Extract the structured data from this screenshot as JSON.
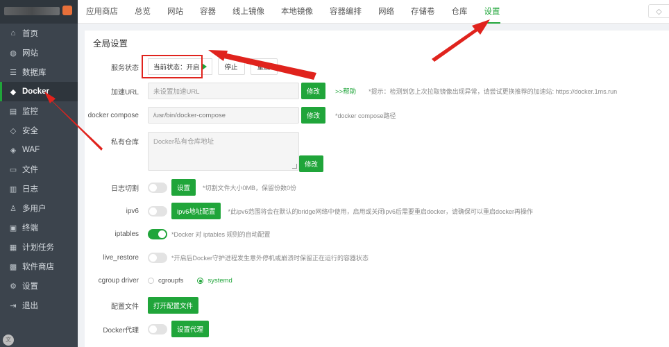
{
  "sidebar": {
    "items": [
      {
        "icon": "home-icon",
        "glyph": "⌂",
        "label": "首页"
      },
      {
        "icon": "globe-icon",
        "glyph": "◍",
        "label": "网站"
      },
      {
        "icon": "database-icon",
        "glyph": "☰",
        "label": "数据库"
      },
      {
        "icon": "docker-icon",
        "glyph": "◆",
        "label": "Docker"
      },
      {
        "icon": "monitor-icon",
        "glyph": "▤",
        "label": "监控"
      },
      {
        "icon": "shield-icon",
        "glyph": "◇",
        "label": "安全"
      },
      {
        "icon": "waf-shield-icon",
        "glyph": "◈",
        "label": "WAF"
      },
      {
        "icon": "folder-icon",
        "glyph": "▭",
        "label": "文件"
      },
      {
        "icon": "log-icon",
        "glyph": "▥",
        "label": "日志"
      },
      {
        "icon": "users-icon",
        "glyph": "♙",
        "label": "多用户"
      },
      {
        "icon": "terminal-icon",
        "glyph": "▣",
        "label": "终端"
      },
      {
        "icon": "schedule-icon",
        "glyph": "▦",
        "label": "计划任务"
      },
      {
        "icon": "store-icon",
        "glyph": "▩",
        "label": "软件商店"
      },
      {
        "icon": "gear-icon",
        "glyph": "⚙",
        "label": "设置"
      },
      {
        "icon": "logout-icon",
        "glyph": "⇥",
        "label": "退出"
      }
    ],
    "active_index": 3,
    "avatar_text": "文"
  },
  "tabs": [
    "应用商店",
    "总览",
    "网站",
    "容器",
    "线上镜像",
    "本地镜像",
    "容器编排",
    "网络",
    "存储卷",
    "仓库",
    "设置"
  ],
  "active_tab": "设置",
  "panel": {
    "title": "全局设置",
    "service": {
      "label": "服务状态",
      "status": "当前状态：开启",
      "stop": "停止",
      "restart": "重启"
    },
    "accel": {
      "label": "加速URL",
      "placeholder": "未设置加速URL",
      "button": "修改",
      "help": ">>帮助",
      "hint": "*提示：检测到您上次拉取镜像出现异常，请尝试更换推荐的加速站: https://docker.1ms.run"
    },
    "compose": {
      "label": "docker compose",
      "value": "/usr/bin/docker-compose",
      "button": "修改",
      "hint": "*docker compose路径"
    },
    "registry": {
      "label": "私有仓库",
      "placeholder": "Docker私有仓库地址",
      "button": "修改"
    },
    "logcut": {
      "label": "日志切割",
      "button": "设置",
      "hint": "*切割文件大小0MB，保留份数0份"
    },
    "ipv6": {
      "label": "ipv6",
      "button": "ipv6地址配置",
      "hint": "*此ipv6范围将会在默认的bridge网络中使用，启用或关闭ipv6后需要重启docker，请确保可以重启docker再操作"
    },
    "iptables": {
      "label": "iptables",
      "hint": "*Docker 对 iptables 规则的自动配置",
      "enabled": true
    },
    "live_restore": {
      "label": "live_restore",
      "hint": "*开启后Docker守护进程发生意外停机或崩溃时保留正在运行的容器状态"
    },
    "cgroup": {
      "label": "cgroup driver",
      "options": [
        "cgroupfs",
        "systemd"
      ],
      "selected": "systemd"
    },
    "config": {
      "label": "配置文件",
      "button": "打开配置文件"
    },
    "proxy": {
      "label": "Docker代理",
      "button": "设置代理"
    }
  },
  "colors": {
    "accent": "#20a53a",
    "annotation": "#e0231d",
    "sidebar": "#3c444d"
  }
}
